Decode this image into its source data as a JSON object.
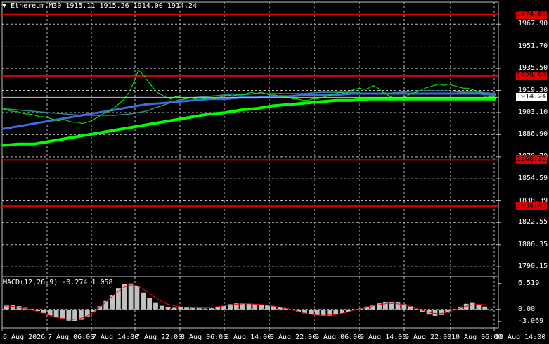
{
  "header": {
    "triangle_icon": "triangle-down-icon",
    "text": "Ethereum,M30  1915.11 1915.26 1914.00 1914.24"
  },
  "price_axis": {
    "labels": [
      "1967.90",
      "1951.70",
      "1935.50",
      "1919.30",
      "1903.10",
      "1886.90",
      "1870.70",
      "1854.59",
      "1838.39",
      "1822.55",
      "1806.35",
      "1790.15"
    ]
  },
  "horizontal_lines": [
    {
      "label": "1974.85",
      "color": "#e00000"
    },
    {
      "label": "1929.98",
      "color": "#e00000"
    },
    {
      "label": "1868.35",
      "color": "#e00000"
    },
    {
      "label": "1834.43",
      "color": "#e00000"
    }
  ],
  "current_price": {
    "label": "1914.24"
  },
  "time_axis": {
    "labels": [
      "6 Aug 2026",
      "7 Aug 06:00",
      "7 Aug 14:00",
      "7 Aug 22:00",
      "8 Aug 06:00",
      "8 Aug 14:00",
      "8 Aug 22:00",
      "9 Aug 06:00",
      "9 Aug 14:00",
      "9 Aug 22:00",
      "10 Aug 06:00",
      "10 Aug 14:00"
    ]
  },
  "macd": {
    "label": "MACD(12,26,9) -0.274 1.058",
    "axis_labels": [
      "6.519",
      "0.00",
      "-3.069"
    ]
  },
  "colors": {
    "background": "#000000",
    "grid": "#c0c0c0",
    "price_line": "#00ff00",
    "ma_fast": "#1e90ff",
    "ma_mid": "#4169e1",
    "ma_slow": "#00ff00",
    "hline": "#ff0000",
    "macd_hist": "#c0c0c0",
    "macd_signal": "#ff0000"
  },
  "chart_data": {
    "type": "line",
    "title": "",
    "price_series": [
      1906,
      1905,
      1904,
      1904,
      1903,
      1902,
      1902,
      1901,
      1900,
      1900,
      1899,
      1898,
      1897,
      1898,
      1897,
      1896,
      1896,
      1895,
      1896,
      1897,
      1899,
      1901,
      1903,
      1905,
      1907,
      1910,
      1913,
      1918,
      1925,
      1934,
      1931,
      1926,
      1922,
      1918,
      1916,
      1914,
      1913,
      1915,
      1914,
      1913,
      1914,
      1913,
      1914,
      1913,
      1914,
      1913,
      1914,
      1915,
      1916,
      1915,
      1916,
      1916,
      1917,
      1918,
      1917,
      1918,
      1917,
      1916,
      1916,
      1915,
      1915,
      1914,
      1913,
      1913,
      1912,
      1912,
      1913,
      1913,
      1914,
      1915,
      1916,
      1917,
      1918,
      1917,
      1919,
      1920,
      1921,
      1920,
      1921,
      1923,
      1921,
      1918,
      1916,
      1914,
      1913,
      1914,
      1915,
      1917,
      1918,
      1919,
      1921,
      1922,
      1923,
      1924,
      1923,
      1924,
      1923,
      1922,
      1921,
      1921,
      1920,
      1919,
      1918,
      1914,
      1915,
      1914.24
    ],
    "ma_fast_series": [
      1906,
      1905,
      1904,
      1903,
      1902,
      1901,
      1901,
      1901,
      1902,
      1904,
      1908,
      1912,
      1914,
      1915,
      1916,
      1916,
      1917,
      1917,
      1917,
      1917,
      1918,
      1918,
      1918,
      1917,
      1917,
      1918,
      1919,
      1919,
      1919,
      1918,
      1918,
      1917
    ],
    "ma_mid_series": [
      1891,
      1893,
      1895,
      1897,
      1899,
      1901,
      1903,
      1905,
      1907,
      1909,
      1910,
      1911,
      1912,
      1913,
      1913,
      1914,
      1914,
      1915,
      1915,
      1916,
      1916,
      1916,
      1917,
      1917,
      1917,
      1917,
      1917,
      1917,
      1917,
      1917,
      1917,
      1916
    ],
    "ma_slow_series": [
      1879,
      1880,
      1880,
      1882,
      1884,
      1886,
      1888,
      1890,
      1892,
      1894,
      1896,
      1898,
      1900,
      1902,
      1903,
      1905,
      1906,
      1908,
      1909,
      1910,
      1911,
      1912,
      1912,
      1913,
      1913,
      1913,
      1913,
      1913,
      1913,
      1913,
      1913,
      1913
    ],
    "macd_histogram": [
      1.2,
      1.0,
      0.8,
      0.4,
      0.1,
      -0.4,
      -0.9,
      -1.5,
      -2.0,
      -2.5,
      -2.8,
      -3.0,
      -2.6,
      -1.8,
      -0.6,
      0.8,
      2.1,
      3.6,
      5.2,
      6.3,
      6.5,
      5.8,
      4.2,
      2.8,
      1.6,
      0.9,
      0.6,
      0.4,
      0.5,
      0.5,
      0.4,
      0.3,
      0.2,
      0.3,
      0.5,
      0.9,
      1.3,
      1.5,
      1.5,
      1.4,
      1.3,
      1.2,
      1.0,
      0.8,
      0.6,
      0.3,
      -0.1,
      -0.6,
      -1.0,
      -1.2,
      -1.4,
      -1.6,
      -1.6,
      -1.3,
      -1.0,
      -0.6,
      -0.2,
      0.3,
      0.7,
      1.1,
      1.5,
      1.8,
      1.9,
      1.7,
      1.3,
      0.8,
      0.1,
      -0.6,
      -1.3,
      -1.6,
      -1.4,
      -0.8,
      -0.1,
      0.7,
      1.4,
      1.6,
      1.3,
      0.7,
      -0.27
    ],
    "macd_signal": [
      0.9,
      0.8,
      0.6,
      0.3,
      0.0,
      -0.4,
      -0.9,
      -1.4,
      -1.9,
      -2.2,
      -2.4,
      -2.5,
      -2.3,
      -1.8,
      -0.9,
      0.3,
      1.6,
      3.0,
      4.4,
      5.5,
      6.1,
      6.0,
      5.2,
      4.1,
      3.0,
      2.0,
      1.3,
      0.9,
      0.6,
      0.5,
      0.4,
      0.4,
      0.4,
      0.5,
      0.7,
      0.9,
      1.1,
      1.3,
      1.4,
      1.4,
      1.3,
      1.2,
      1.0,
      0.8,
      0.5,
      0.2,
      -0.2,
      -0.6,
      -1.0,
      -1.3,
      -1.5,
      -1.5,
      -1.4,
      -1.2,
      -0.9,
      -0.5,
      -0.1,
      0.3,
      0.7,
      1.0,
      1.3,
      1.5,
      1.5,
      1.3,
      1.0,
      0.5,
      0.0,
      -0.5,
      -0.9,
      -1.1,
      -0.9,
      -0.5,
      0.1,
      0.6,
      1.0,
      1.2,
      1.2,
      1.1,
      1.058
    ],
    "ylim": [
      1783.0,
      1984.0
    ],
    "macd_ylim": [
      -4.6,
      8.2
    ]
  }
}
